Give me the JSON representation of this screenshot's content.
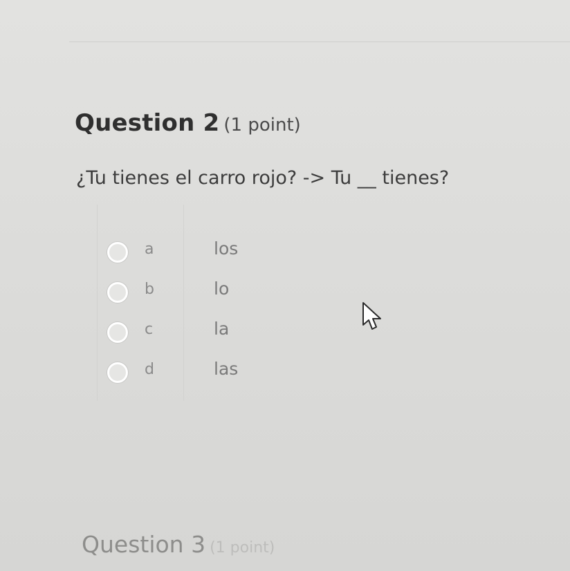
{
  "question": {
    "title": "Question 2",
    "points": "(1 point)",
    "prompt": "¿Tu tienes el carro rojo? -> Tu __ tienes?",
    "options": [
      {
        "letter": "a",
        "text": "los"
      },
      {
        "letter": "b",
        "text": "lo"
      },
      {
        "letter": "c",
        "text": "la"
      },
      {
        "letter": "d",
        "text": "las"
      }
    ]
  },
  "next_question": {
    "title": "Question 3",
    "points": "(1 point)"
  }
}
